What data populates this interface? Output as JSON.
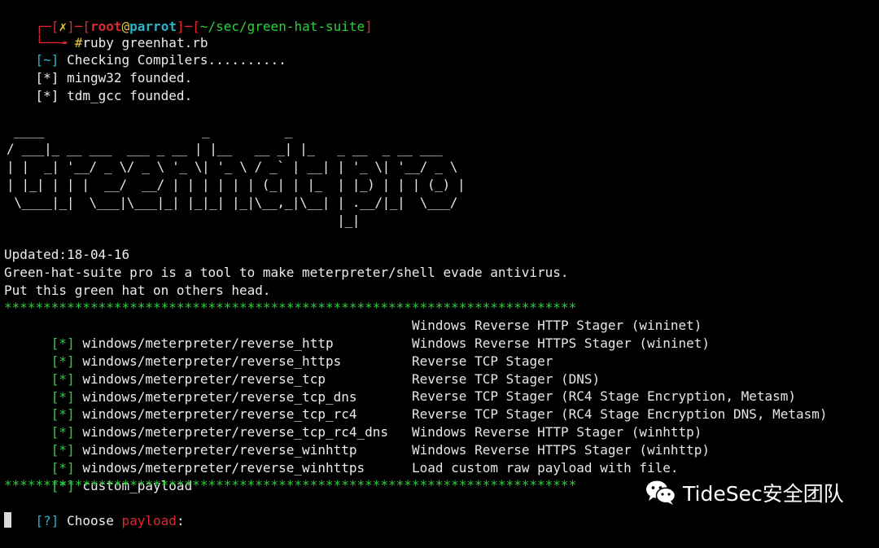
{
  "prompt": {
    "bracket_open": "┌─[",
    "status_mark": "✗",
    "bracket_mid": "]─[",
    "user": "root",
    "at": "@",
    "host": "parrot",
    "bracket_mid2": "]─[",
    "path": "~/sec/green-hat-suite",
    "bracket_close": "]",
    "second_prefix": "└──╼ ",
    "hash": "#",
    "command": "ruby greenhat.rb"
  },
  "checks": [
    {
      "tag": "[~]",
      "text": " Checking Compilers.........."
    },
    {
      "tag": "[*]",
      "text": " mingw32 founded."
    },
    {
      "tag": "[*]",
      "text": " tdm_gcc founded."
    }
  ],
  "banner_art": " ____                     _          _\n/ ___|_ __ ___  ___ _ __ | |__   __ _| |_   _ __  _ __ ___\n| |  _| '__/ _ \\/ _ \\ '_ \\| '_ \\ / _` | __| | '_ \\| '__/ _ \\\n| |_| | | |  __/  __/ | | | | | | (_| | |_  | |_) | | | (_) |\n \\____|_|  \\___|\\___|_| |_|_| |_|\\__,_|\\__| | .__/|_|  \\___/\n                                            |_|",
  "info": {
    "updated": "Updated:18-04-16",
    "description": "Green-hat-suite pro is a tool to make meterpreter/shell evade antivirus.",
    "tagline": "Put this green hat on others head."
  },
  "separator": "*************************************************************************",
  "payloads": [
    {
      "tag": "[*]",
      "name": " windows/meterpreter/reverse_http",
      "desc": "Windows Reverse HTTP Stager (wininet)"
    },
    {
      "tag": "[*]",
      "name": " windows/meterpreter/reverse_https",
      "desc": "Windows Reverse HTTPS Stager (wininet)"
    },
    {
      "tag": "[*]",
      "name": " windows/meterpreter/reverse_tcp",
      "desc": "Reverse TCP Stager"
    },
    {
      "tag": "[*]",
      "name": " windows/meterpreter/reverse_tcp_dns",
      "desc": "Reverse TCP Stager (DNS)"
    },
    {
      "tag": "[*]",
      "name": " windows/meterpreter/reverse_tcp_rc4",
      "desc": "Reverse TCP Stager (RC4 Stage Encryption, Metasm)"
    },
    {
      "tag": "[*]",
      "name": " windows/meterpreter/reverse_tcp_rc4_dns",
      "desc": "Reverse TCP Stager (RC4 Stage Encryption DNS, Metasm)"
    },
    {
      "tag": "[*]",
      "name": " windows/meterpreter/reverse_winhttp",
      "desc": "Windows Reverse HTTP Stager (winhttp)"
    },
    {
      "tag": "[*]",
      "name": " windows/meterpreter/reverse_winhttps",
      "desc": "Windows Reverse HTTPS Stager (winhttp)"
    },
    {
      "tag": "[*]",
      "name": " custom_payload",
      "desc": "Load custom raw payload with file."
    }
  ],
  "choose": {
    "tag": "[?]",
    "text": " Choose ",
    "keyword": "payload",
    "colon": ":"
  },
  "watermark": {
    "icon": "wechat-icon",
    "text": "TideSec安全团队"
  },
  "colors": {
    "background": "#000000",
    "red": "#e0262e",
    "green": "#2fcf3f",
    "cyan": "#2bb3c7",
    "yellow": "#e2c93a",
    "text": "#dcdcdc"
  }
}
